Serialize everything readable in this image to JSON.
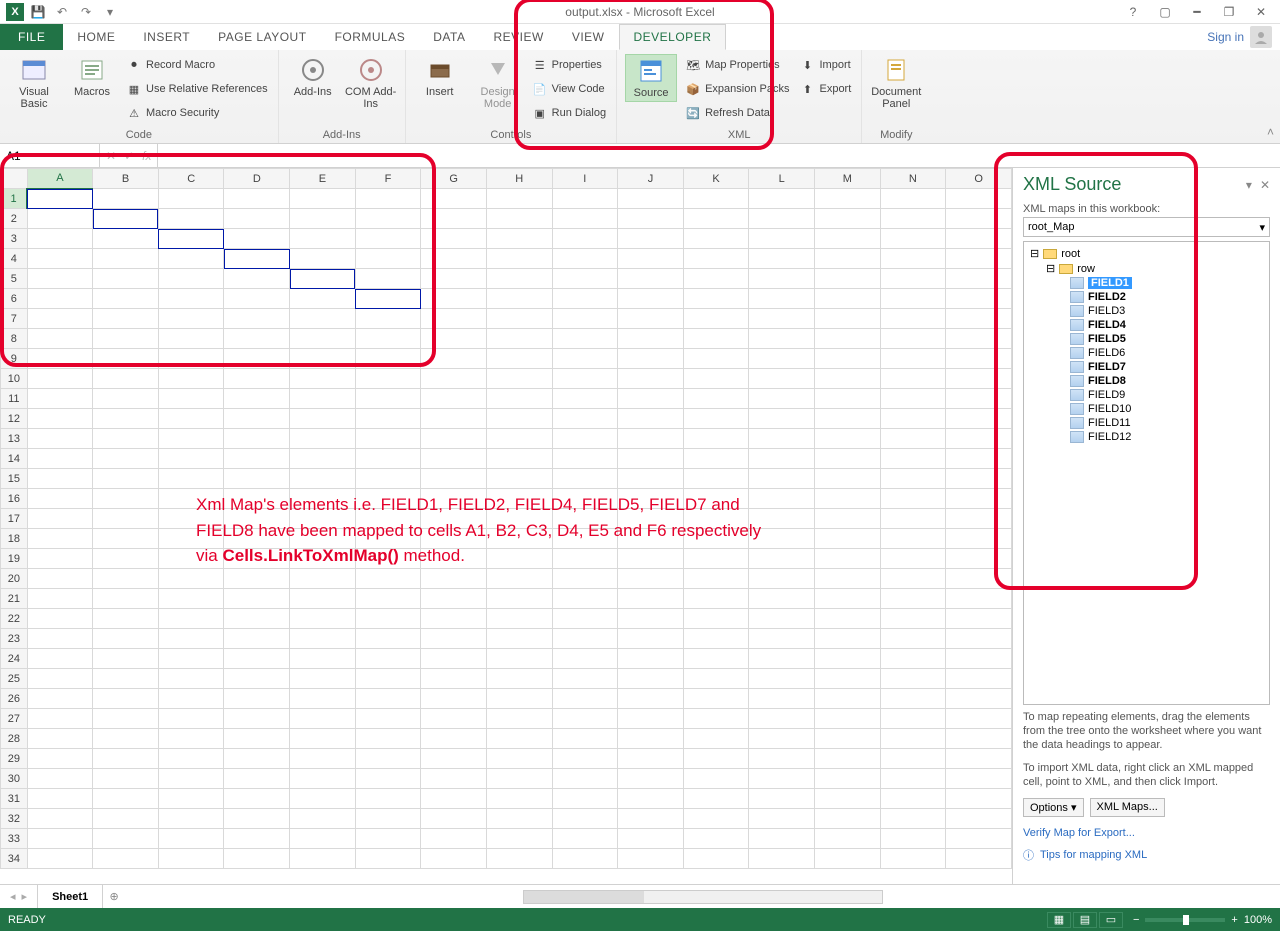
{
  "title": "output.xlsx - Microsoft Excel",
  "signin": "Sign in",
  "tabs": {
    "file": "FILE",
    "home": "HOME",
    "insert": "INSERT",
    "page": "PAGE LAYOUT",
    "formulas": "FORMULAS",
    "data": "DATA",
    "review": "REVIEW",
    "view": "VIEW",
    "developer": "DEVELOPER"
  },
  "ribbon": {
    "code": {
      "label": "Code",
      "visual_basic": "Visual Basic",
      "macros": "Macros",
      "record": "Record Macro",
      "relrefs": "Use Relative References",
      "security": "Macro Security"
    },
    "addins": {
      "label": "Add-Ins",
      "addins": "Add-Ins",
      "com": "COM Add-Ins"
    },
    "controls": {
      "label": "Controls",
      "insert": "Insert",
      "design": "Design Mode",
      "props": "Properties",
      "viewcode": "View Code",
      "rundlg": "Run Dialog"
    },
    "xml": {
      "label": "XML",
      "source": "Source",
      "mapprops": "Map Properties",
      "expansion": "Expansion Packs",
      "refresh": "Refresh Data",
      "import": "Import",
      "export": "Export"
    },
    "modify": {
      "label": "Modify",
      "docpanel": "Document Panel"
    }
  },
  "namebox": "A1",
  "columns": [
    "A",
    "B",
    "C",
    "D",
    "E",
    "F",
    "G",
    "H",
    "I",
    "J",
    "K",
    "L",
    "M",
    "N",
    "O"
  ],
  "rows": 34,
  "mapped_cells": [
    "A1",
    "B2",
    "C3",
    "D4",
    "E5",
    "F6"
  ],
  "annotation": {
    "l1": "Xml Map's elements i.e. FIELD1, FIELD2, FIELD4, FIELD5, FIELD7 and",
    "l2": "FIELD8 have been mapped to cells A1, B2, C3, D4, E5 and F6 respectively",
    "l3a": "via ",
    "l3b": "Cells.LinkToXmlMap()",
    "l3c": " method."
  },
  "taskpane": {
    "title": "XML Source",
    "maps_label": "XML maps in this workbook:",
    "selected_map": "root_Map",
    "root": "root",
    "row": "row",
    "fields": [
      {
        "name": "FIELD1",
        "sel": true,
        "bold": true
      },
      {
        "name": "FIELD2",
        "sel": false,
        "bold": true
      },
      {
        "name": "FIELD3",
        "sel": false,
        "bold": false
      },
      {
        "name": "FIELD4",
        "sel": false,
        "bold": true
      },
      {
        "name": "FIELD5",
        "sel": false,
        "bold": true
      },
      {
        "name": "FIELD6",
        "sel": false,
        "bold": false
      },
      {
        "name": "FIELD7",
        "sel": false,
        "bold": true
      },
      {
        "name": "FIELD8",
        "sel": false,
        "bold": true
      },
      {
        "name": "FIELD9",
        "sel": false,
        "bold": false
      },
      {
        "name": "FIELD10",
        "sel": false,
        "bold": false
      },
      {
        "name": "FIELD11",
        "sel": false,
        "bold": false
      },
      {
        "name": "FIELD12",
        "sel": false,
        "bold": false
      }
    ],
    "hint1": "To map repeating elements, drag the elements from the tree onto the worksheet where you want the data headings to appear.",
    "hint2": "To import XML data, right click an XML mapped cell, point to XML, and then click Import.",
    "options": "Options ▾",
    "xmlmaps": "XML Maps...",
    "verify": "Verify Map for Export...",
    "tips": "Tips for mapping XML"
  },
  "sheet": "Sheet1",
  "status": "READY",
  "zoom": "100%"
}
